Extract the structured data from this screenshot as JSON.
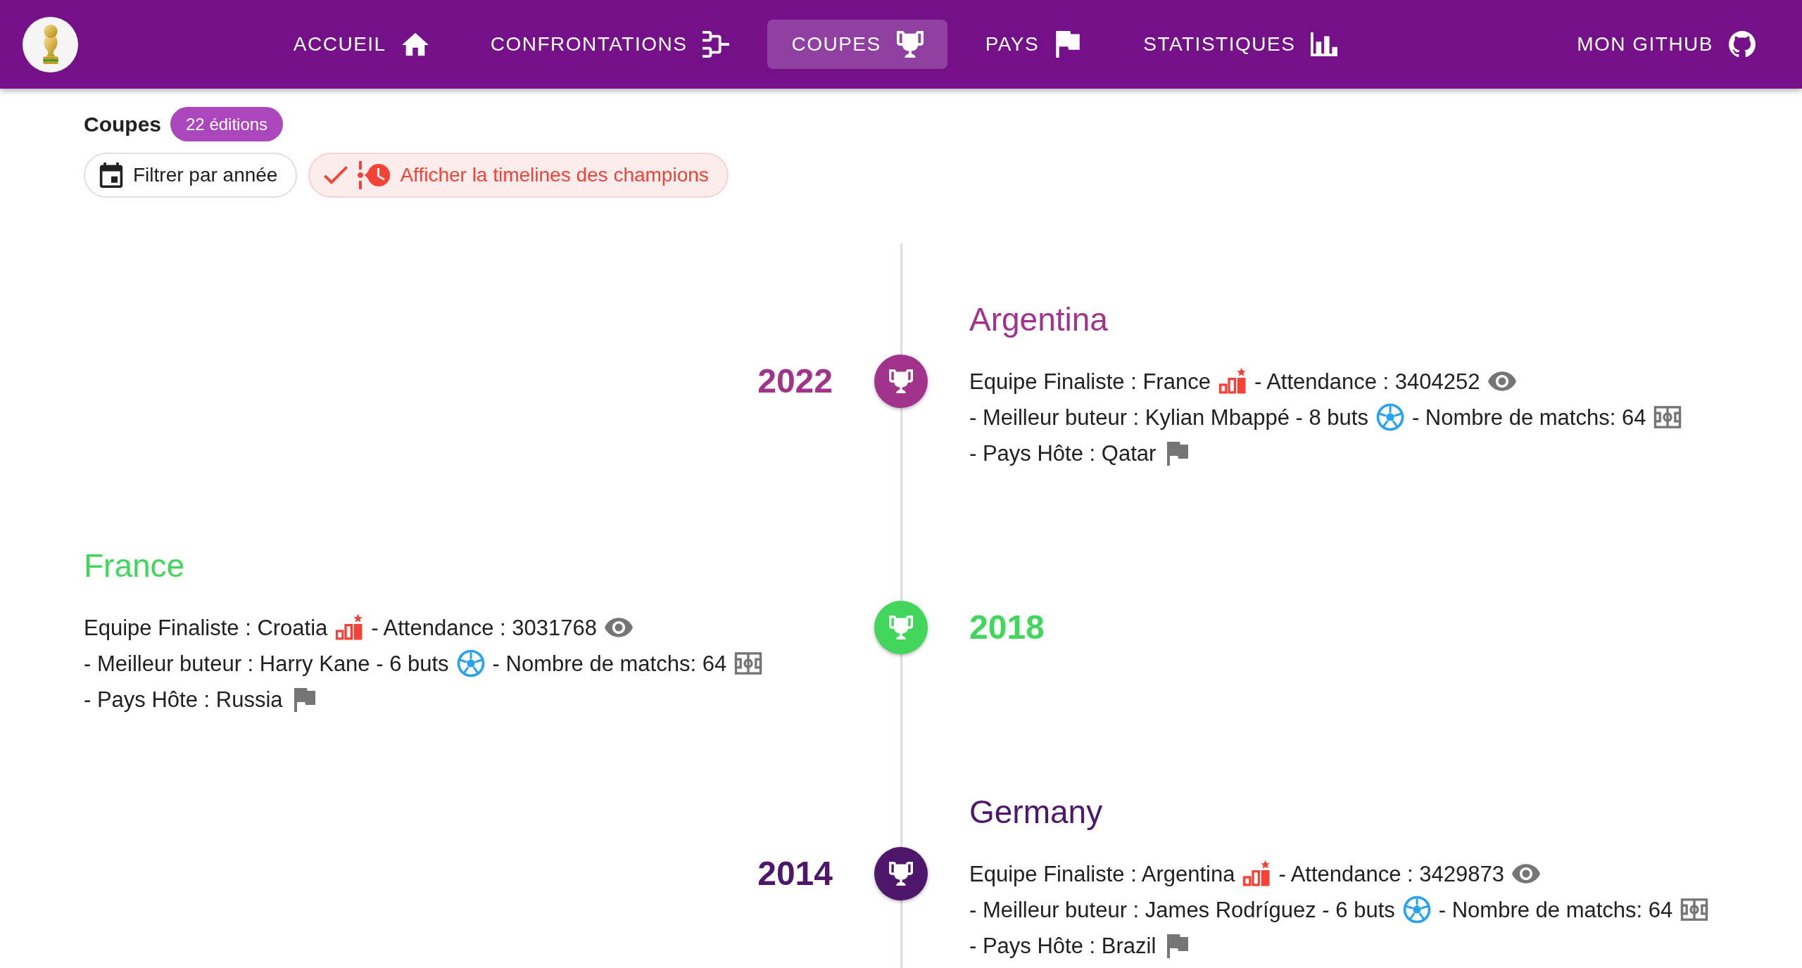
{
  "nav": {
    "items": [
      {
        "label": "ACCUEIL",
        "kind": "home",
        "selected": false
      },
      {
        "label": "CONFRONTATIONS",
        "kind": "bracket",
        "selected": false
      },
      {
        "label": "COUPES",
        "kind": "trophy",
        "selected": true
      },
      {
        "label": "PAYS",
        "kind": "flag",
        "selected": false
      },
      {
        "label": "STATISTIQUES",
        "kind": "chart",
        "selected": false
      }
    ],
    "github_link": {
      "label": "MON GITHUB"
    }
  },
  "header": {
    "title": "Coupes",
    "badge": "22 éditions"
  },
  "chips": [
    {
      "label": "Filtrer par année",
      "kind": "filter",
      "selected": false
    },
    {
      "label": "Afficher la timelines des champions",
      "kind": "timeline",
      "selected": true
    }
  ],
  "timeline": [
    {
      "year": "2022",
      "winner": "Argentina",
      "color": "#a2338d",
      "details": [
        {
          "kind": "finalist",
          "text": "Equipe Finaliste : France"
        },
        {
          "kind": "attendance",
          "text": "- Attendance : 3404252"
        },
        {
          "kind": "scorer",
          "text": "- Meilleur buteur : Kylian Mbappé - 8 buts"
        },
        {
          "kind": "matches",
          "text": "- Nombre de matchs: 64"
        },
        {
          "kind": "host",
          "text": "- Pays Hôte : Qatar"
        }
      ]
    },
    {
      "year": "2018",
      "winner": "France",
      "color": "#43d65c",
      "details": [
        {
          "kind": "finalist",
          "text": "Equipe Finaliste : Croatia"
        },
        {
          "kind": "attendance",
          "text": "- Attendance : 3031768"
        },
        {
          "kind": "scorer",
          "text": "- Meilleur buteur : Harry Kane - 6 buts"
        },
        {
          "kind": "matches",
          "text": "- Nombre de matchs: 64"
        },
        {
          "kind": "host",
          "text": "- Pays Hôte : Russia"
        }
      ]
    },
    {
      "year": "2014",
      "winner": "Germany",
      "color": "#4f176b",
      "details": [
        {
          "kind": "finalist",
          "text": "Equipe Finaliste : Argentina"
        },
        {
          "kind": "attendance",
          "text": "- Attendance : 3429873"
        },
        {
          "kind": "scorer",
          "text": "- Meilleur buteur : James Rodríguez - 6 buts"
        },
        {
          "kind": "matches",
          "text": "- Nombre de matchs: 64"
        },
        {
          "kind": "host",
          "text": "- Pays Hôte : Brazil"
        }
      ]
    }
  ]
}
